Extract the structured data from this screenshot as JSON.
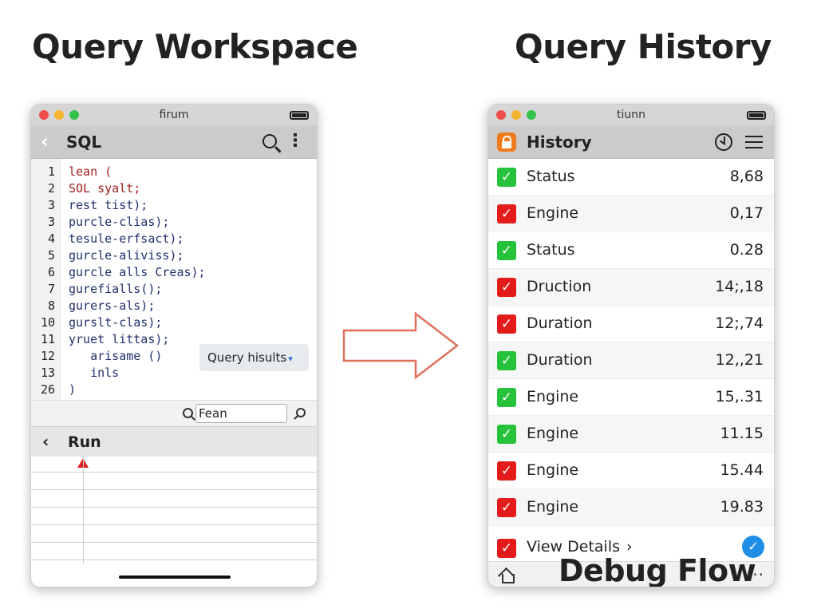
{
  "headings": {
    "left": "Query Workspace",
    "right": "Query History"
  },
  "workspace": {
    "window_title": "firum",
    "nav_title": "SQL",
    "code_lines": [
      {
        "num": "1",
        "text": "lean (",
        "style": "kw"
      },
      {
        "num": "2",
        "text": "SOL syalt;",
        "style": "kw"
      },
      {
        "num": "3",
        "text": "rest tist);",
        "style": "plain"
      },
      {
        "num": "3",
        "text": "purcle-clias);",
        "style": "plain"
      },
      {
        "num": "4",
        "text": "tesule-erfsact);",
        "style": "plain"
      },
      {
        "num": "5",
        "text": "gurcle-aliviss);",
        "style": "plain"
      },
      {
        "num": "6",
        "text": "gurcle alls Creas);",
        "style": "plain"
      },
      {
        "num": "7",
        "text": "gurefialls();",
        "style": "plain"
      },
      {
        "num": "8",
        "text": "gurers-als);",
        "style": "plain"
      },
      {
        "num": "10",
        "text": "gurslt-clas);",
        "style": "plain"
      },
      {
        "num": "11",
        "text": "yruet littas);",
        "style": "plain"
      },
      {
        "num": "12",
        "text": "   arisame ()",
        "style": "plain"
      },
      {
        "num": "13",
        "text": "   inls",
        "style": "plain"
      },
      {
        "num": "26",
        "text": ")",
        "style": "plain"
      }
    ],
    "results_dropdown": "Query hisults",
    "search_value": "Fean",
    "run_label": "Run"
  },
  "history": {
    "window_title": "tiunn",
    "nav_title": "History",
    "rows": [
      {
        "label": "Status",
        "value": "8,68",
        "status": "ok"
      },
      {
        "label": "Engine",
        "value": "0,17",
        "status": "err"
      },
      {
        "label": "Status",
        "value": "0.28",
        "status": "ok"
      },
      {
        "label": "Druction",
        "value": "14;,18",
        "status": "err"
      },
      {
        "label": "Duration",
        "value": "12;,74",
        "status": "err"
      },
      {
        "label": "Duration",
        "value": "12,,21",
        "status": "ok"
      },
      {
        "label": "Engine",
        "value": "15,.31",
        "status": "ok"
      },
      {
        "label": "Engine",
        "value": "11.15",
        "status": "ok"
      },
      {
        "label": "Engine",
        "value": "15.44",
        "status": "err"
      },
      {
        "label": "Engine",
        "value": "19.83",
        "status": "err"
      }
    ],
    "details_label": "View Details",
    "footer_text": "Debug Flow"
  },
  "colors": {
    "ok": "#26c23a",
    "err": "#e31b1b",
    "accent_blue": "#1e8ee6",
    "lock_orange": "#f07b1c",
    "arrow": "#e0705a"
  },
  "icons": {
    "check": "✓",
    "cross": "✓",
    "chevron_left": "‹",
    "chevron_right": "›",
    "chevron_down": "▾",
    "more_vertical": "⋮",
    "more_horizontal": "···"
  }
}
